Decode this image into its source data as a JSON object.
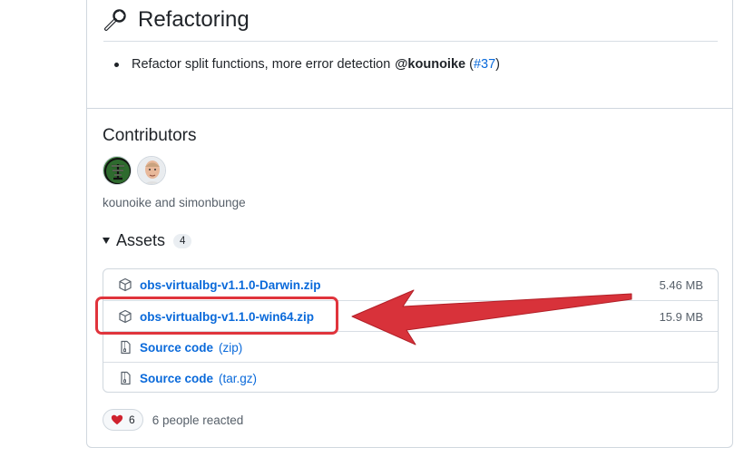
{
  "section": {
    "title": "Refactoring",
    "bullet_text": "Refactor split functions, more error detection",
    "mention": "@kounoike",
    "paren_open": "(",
    "issue": "#37",
    "paren_close": ")"
  },
  "contributors": {
    "title": "Contributors",
    "names": "kounoike and simonbunge"
  },
  "assets": {
    "title": "Assets",
    "count": "4",
    "items": [
      {
        "name": "obs-virtualbg-v1.1.0-Darwin.zip",
        "size": "5.46 MB"
      },
      {
        "name": "obs-virtualbg-v1.1.0-win64.zip",
        "size": "15.9 MB"
      },
      {
        "name": "Source code",
        "sub": "(zip)"
      },
      {
        "name": "Source code",
        "sub": "(tar.gz)"
      }
    ]
  },
  "reactions": {
    "count": "6",
    "text": "6 people reacted"
  },
  "colors": {
    "link": "#0969da",
    "highlight": "#e0343c"
  }
}
